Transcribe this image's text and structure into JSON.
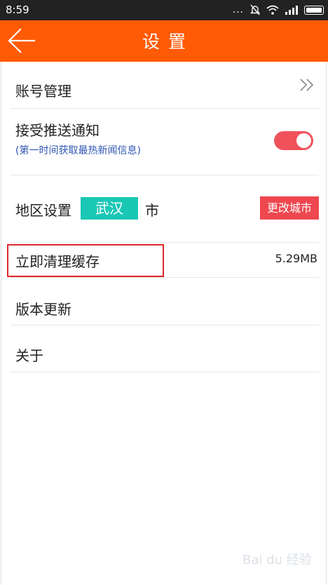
{
  "status_bar": {
    "time": "8:59",
    "dots": "...",
    "icons": [
      "mute-icon",
      "wifi-icon",
      "signal-icon",
      "battery-icon"
    ]
  },
  "app_bar": {
    "title": "设置",
    "back_icon": "arrow-left-icon",
    "color": "#ff5a05"
  },
  "settings": {
    "account": {
      "label": "账号管理",
      "icon": "double-chevron-right-icon"
    },
    "push": {
      "label": "接受推送通知",
      "sublabel": "(第一时间获取最热新闻信息)",
      "enabled": true,
      "toggle_color": "#f0525c"
    },
    "region": {
      "label": "地区设置",
      "city": "武汉",
      "suffix": "市",
      "change_button": "更改城市"
    },
    "cache": {
      "label": "立即清理缓存",
      "size": "5.29MB"
    },
    "update": {
      "label": "版本更新"
    },
    "about": {
      "label": "关于"
    }
  },
  "watermark": {
    "text": "Bai du 经验"
  }
}
